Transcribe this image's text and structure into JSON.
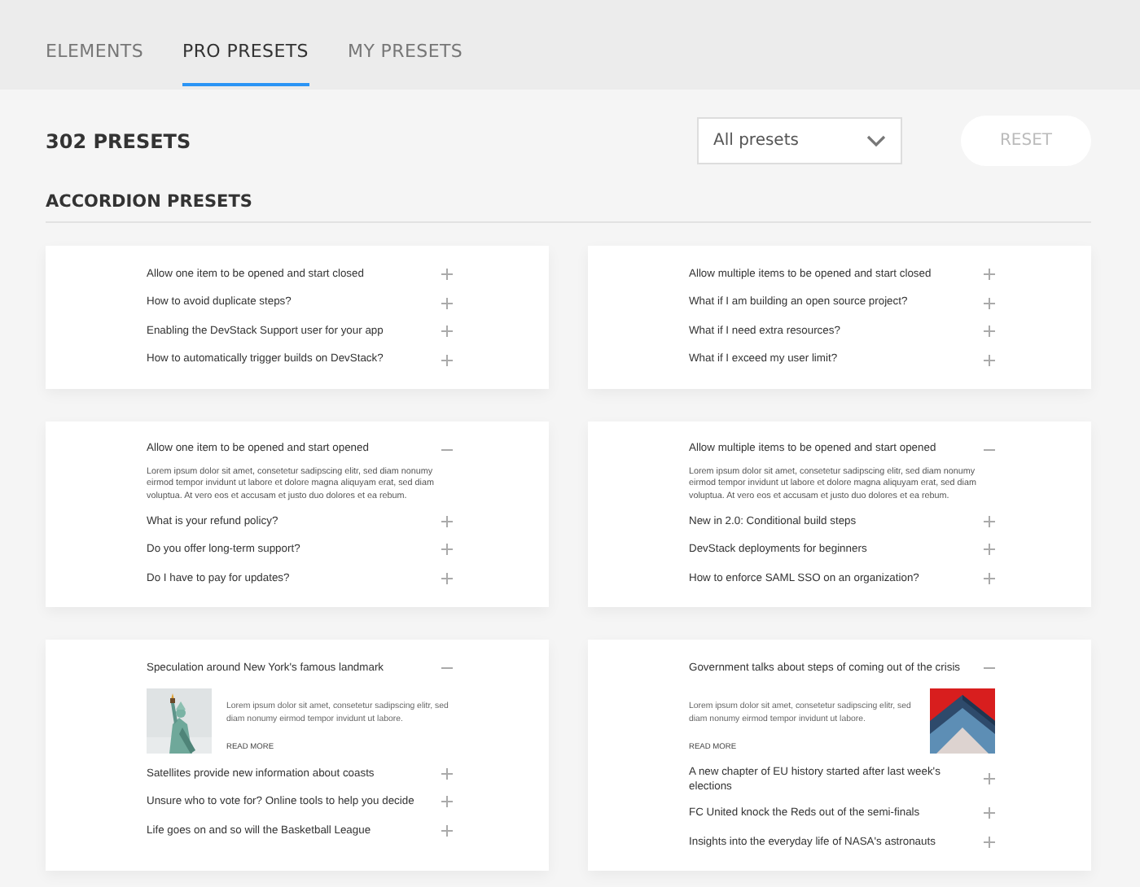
{
  "tabs": [
    {
      "label": "ELEMENTS",
      "selected": false
    },
    {
      "label": "PRO PRESETS",
      "selected": true
    },
    {
      "label": "MY PRESETS",
      "selected": false
    }
  ],
  "count": "302 PRESETS",
  "filter": {
    "value": "All presets"
  },
  "reset": {
    "label": "RESET",
    "disabled": true
  },
  "section_title": "ACCORDION PRESETS",
  "cards": [
    {
      "items": [
        {
          "title": "Allow one item to be opened and start closed",
          "expanded": false
        },
        {
          "title": "How to avoid duplicate steps?",
          "expanded": false
        },
        {
          "title": "Enabling the DevStack Support user for your app",
          "expanded": false
        },
        {
          "title": "How to automatically trigger builds on DevStack?",
          "expanded": false
        }
      ]
    },
    {
      "items": [
        {
          "title": "Allow multiple items to be opened and start closed",
          "expanded": false
        },
        {
          "title": "What if I am building an open source project?",
          "expanded": false
        },
        {
          "title": "What if I need extra resources?",
          "expanded": false
        },
        {
          "title": "What if I exceed my user limit?",
          "expanded": false
        }
      ]
    },
    {
      "items": [
        {
          "title": "Allow one item to be opened and start opened",
          "expanded": true,
          "body": {
            "kind": "text",
            "text": "Lorem ipsum dolor sit amet, consetetur sadipscing elitr, sed diam nonumy eirmod tempor invidunt ut labore et dolore magna aliquyam erat, sed diam voluptua. At vero eos et accusam et justo duo dolores et ea rebum."
          }
        },
        {
          "title": "What is your refund policy?",
          "expanded": false
        },
        {
          "title": "Do you offer long-term support?",
          "expanded": false
        },
        {
          "title": "Do I have to pay for updates?",
          "expanded": false
        }
      ]
    },
    {
      "items": [
        {
          "title": "Allow multiple items to be opened and start opened",
          "expanded": true,
          "body": {
            "kind": "text",
            "text": "Lorem ipsum dolor sit amet, consetetur sadipscing elitr, sed diam nonumy eirmod tempor invidunt ut labore et dolore magna aliquyam erat, sed diam voluptua. At vero eos et accusam et justo duo dolores et ea rebum."
          }
        },
        {
          "title": "New in 2.0: Conditional build steps",
          "expanded": false
        },
        {
          "title": "DevStack deployments for beginners",
          "expanded": false
        },
        {
          "title": "How to enforce SAML SSO on an organization?",
          "expanded": false
        }
      ]
    },
    {
      "items": [
        {
          "title": "Speculation around New York's famous landmark",
          "expanded": true,
          "body": {
            "kind": "picture-left",
            "text": "Lorem ipsum dolor sit amet, consetetur sadipscing elitr, sed diam nonumy eirmod tempor invidunt ut labore.",
            "link": "READ MORE"
          }
        },
        {
          "title": "Satellites provide new information about coasts",
          "expanded": false
        },
        {
          "title": "Unsure who to vote for? Online tools to help you decide",
          "expanded": false
        },
        {
          "title": "Life goes on and so will the Basketball League",
          "expanded": false
        }
      ]
    },
    {
      "items": [
        {
          "title": "Government talks about steps of coming out of the crisis",
          "expanded": true,
          "body": {
            "kind": "picture-right",
            "text": "Lorem ipsum dolor sit amet, consetetur sadipscing elitr, sed diam nonumy eirmod tempor invidunt ut labore.",
            "link": "READ MORE"
          }
        },
        {
          "title": "A new chapter of EU history started after last week's elections",
          "expanded": false
        },
        {
          "title": "FC United knock the Reds out of the semi-finals",
          "expanded": false
        },
        {
          "title": "Insights into the everyday life of NASA's astronauts",
          "expanded": false
        }
      ]
    }
  ]
}
